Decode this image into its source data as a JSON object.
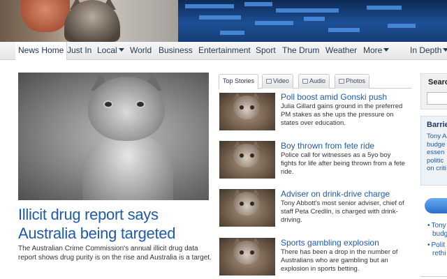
{
  "nav": {
    "items": [
      {
        "label": "News Home",
        "active": true
      },
      {
        "label": "Just In"
      },
      {
        "label": "Local",
        "dropdown": true
      },
      {
        "label": "World"
      },
      {
        "label": "Business"
      },
      {
        "label": "Entertainment"
      },
      {
        "label": "Sport"
      },
      {
        "label": "The Drum"
      },
      {
        "label": "Weather"
      },
      {
        "label": "More",
        "dropdown": true
      },
      {
        "label": "In Depth",
        "dropdown": true
      }
    ]
  },
  "hero": {
    "title": "Illicit drug report says Australia being targeted",
    "summary": "The Australian Crime Commission's annual illicit drug data report shows drug purity is on the rise and Australia is a target."
  },
  "tabs": [
    {
      "label": "Top Stories",
      "active": true
    },
    {
      "label": "Video",
      "icon": "video-icon"
    },
    {
      "label": "Audio",
      "icon": "audio-icon"
    },
    {
      "label": "Photos",
      "icon": "photos-icon"
    }
  ],
  "stories": [
    {
      "headline": "Poll boost amid Gonski push",
      "summary": "Julia Gillard gains ground in the preferred PM stakes as she ups the pressure on states over education."
    },
    {
      "headline": "Boy thrown from fete ride",
      "summary": "Police call for witnesses as a 5yo boy fights for life after being thrown from a fete ride."
    },
    {
      "headline": "Adviser on drink-drive charge",
      "summary": "Tony Abbott's most senior adviser, chief of staff Peta Credlin, is charged with drink-driving."
    },
    {
      "headline": "Sports gambling explosion",
      "summary": "There has been a drop in the number of Australians who are gambling but an explosion in sports betting."
    }
  ],
  "right": {
    "search_label": "Searc",
    "barrier_title": "Barrie",
    "barrier_lines": [
      "Tony A",
      "budge",
      "essen",
      "politic",
      "on criti"
    ],
    "links": [
      [
        "Tony",
        "budg"
      ],
      [
        "Polit",
        "rethi"
      ]
    ]
  }
}
